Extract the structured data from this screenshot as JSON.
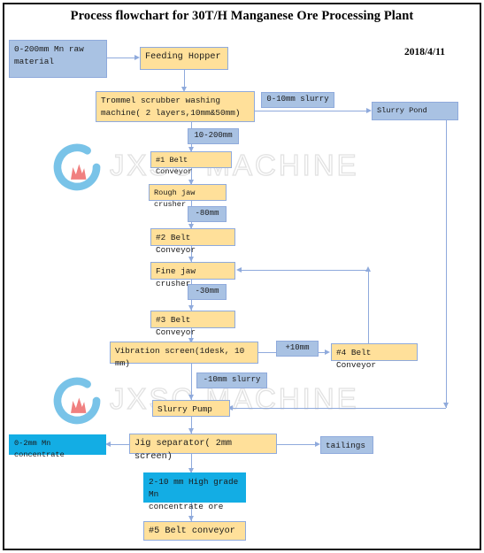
{
  "document": {
    "title": "Process flowchart for 30T/H Manganese Ore Processing Plant",
    "date": "2018/4/11"
  },
  "watermark": {
    "text": "JXSC MACHINE",
    "logo_name": "jxsc-logo"
  },
  "colors": {
    "process_box": "#ffe09a",
    "material_box": "#a9c2e3",
    "product_box": "#13ade4",
    "connector": "#8faadc",
    "border": "#111111"
  },
  "nodes": {
    "raw_material": "0-200mm Mn raw\nmaterial",
    "feeding_hopper": "Feeding Hopper",
    "trommel": "Trommel scrubber washing\nmachine( 2 layers,10mm&50mm)",
    "slurry_pond": "Slurry Pond",
    "belt1": "#1 Belt Conveyor",
    "rough_jaw_crusher": "Rough jaw crusher",
    "belt2": "#2 Belt Conveyor",
    "fine_jaw_crusher": "Fine jaw crusher",
    "belt3": "#3 Belt Conveyor",
    "vibration_screen": "Vibration screen(1desk, 10 mm)",
    "belt4": "#4 Belt Conveyor",
    "slurry_pump": "Slurry Pump",
    "jig_separator": "Jig separator( 2mm screen)",
    "mn_concentrate_0_2": "0-2mm Mn concentrate",
    "tailings": "tailings",
    "high_grade_ore": "2-10 mm High grade Mn\nconcentrate ore",
    "belt5": "#5 Belt conveyor"
  },
  "flow_labels": {
    "slurry_0_10": "0-10mm slurry",
    "size_10_200": "10-200mm",
    "minus_80": "-80mm",
    "minus_30": "-30mm",
    "plus_10": "+10mm",
    "slurry_minus_10": "-10mm slurry"
  }
}
